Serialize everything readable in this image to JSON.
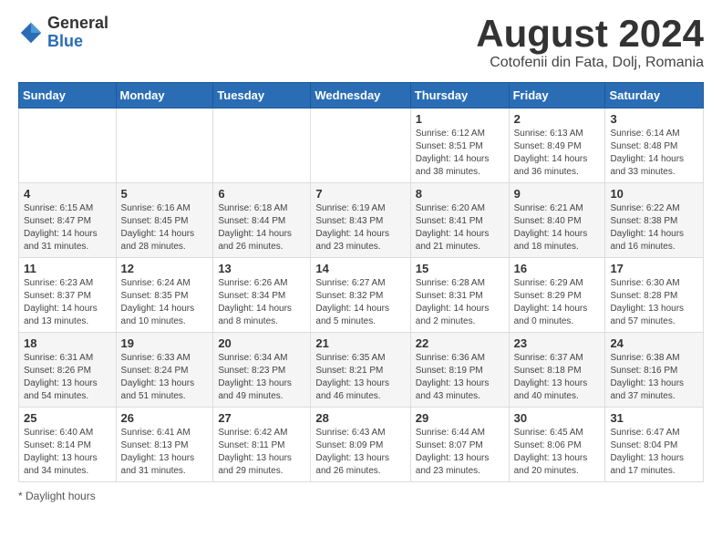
{
  "app": {
    "logo_general": "General",
    "logo_blue": "Blue"
  },
  "header": {
    "month": "August 2024",
    "location": "Cotofenii din Fata, Dolj, Romania"
  },
  "weekdays": [
    "Sunday",
    "Monday",
    "Tuesday",
    "Wednesday",
    "Thursday",
    "Friday",
    "Saturday"
  ],
  "weeks": [
    [
      {
        "day": "",
        "info": ""
      },
      {
        "day": "",
        "info": ""
      },
      {
        "day": "",
        "info": ""
      },
      {
        "day": "",
        "info": ""
      },
      {
        "day": "1",
        "info": "Sunrise: 6:12 AM\nSunset: 8:51 PM\nDaylight: 14 hours and 38 minutes."
      },
      {
        "day": "2",
        "info": "Sunrise: 6:13 AM\nSunset: 8:49 PM\nDaylight: 14 hours and 36 minutes."
      },
      {
        "day": "3",
        "info": "Sunrise: 6:14 AM\nSunset: 8:48 PM\nDaylight: 14 hours and 33 minutes."
      }
    ],
    [
      {
        "day": "4",
        "info": "Sunrise: 6:15 AM\nSunset: 8:47 PM\nDaylight: 14 hours and 31 minutes."
      },
      {
        "day": "5",
        "info": "Sunrise: 6:16 AM\nSunset: 8:45 PM\nDaylight: 14 hours and 28 minutes."
      },
      {
        "day": "6",
        "info": "Sunrise: 6:18 AM\nSunset: 8:44 PM\nDaylight: 14 hours and 26 minutes."
      },
      {
        "day": "7",
        "info": "Sunrise: 6:19 AM\nSunset: 8:43 PM\nDaylight: 14 hours and 23 minutes."
      },
      {
        "day": "8",
        "info": "Sunrise: 6:20 AM\nSunset: 8:41 PM\nDaylight: 14 hours and 21 minutes."
      },
      {
        "day": "9",
        "info": "Sunrise: 6:21 AM\nSunset: 8:40 PM\nDaylight: 14 hours and 18 minutes."
      },
      {
        "day": "10",
        "info": "Sunrise: 6:22 AM\nSunset: 8:38 PM\nDaylight: 14 hours and 16 minutes."
      }
    ],
    [
      {
        "day": "11",
        "info": "Sunrise: 6:23 AM\nSunset: 8:37 PM\nDaylight: 14 hours and 13 minutes."
      },
      {
        "day": "12",
        "info": "Sunrise: 6:24 AM\nSunset: 8:35 PM\nDaylight: 14 hours and 10 minutes."
      },
      {
        "day": "13",
        "info": "Sunrise: 6:26 AM\nSunset: 8:34 PM\nDaylight: 14 hours and 8 minutes."
      },
      {
        "day": "14",
        "info": "Sunrise: 6:27 AM\nSunset: 8:32 PM\nDaylight: 14 hours and 5 minutes."
      },
      {
        "day": "15",
        "info": "Sunrise: 6:28 AM\nSunset: 8:31 PM\nDaylight: 14 hours and 2 minutes."
      },
      {
        "day": "16",
        "info": "Sunrise: 6:29 AM\nSunset: 8:29 PM\nDaylight: 14 hours and 0 minutes."
      },
      {
        "day": "17",
        "info": "Sunrise: 6:30 AM\nSunset: 8:28 PM\nDaylight: 13 hours and 57 minutes."
      }
    ],
    [
      {
        "day": "18",
        "info": "Sunrise: 6:31 AM\nSunset: 8:26 PM\nDaylight: 13 hours and 54 minutes."
      },
      {
        "day": "19",
        "info": "Sunrise: 6:33 AM\nSunset: 8:24 PM\nDaylight: 13 hours and 51 minutes."
      },
      {
        "day": "20",
        "info": "Sunrise: 6:34 AM\nSunset: 8:23 PM\nDaylight: 13 hours and 49 minutes."
      },
      {
        "day": "21",
        "info": "Sunrise: 6:35 AM\nSunset: 8:21 PM\nDaylight: 13 hours and 46 minutes."
      },
      {
        "day": "22",
        "info": "Sunrise: 6:36 AM\nSunset: 8:19 PM\nDaylight: 13 hours and 43 minutes."
      },
      {
        "day": "23",
        "info": "Sunrise: 6:37 AM\nSunset: 8:18 PM\nDaylight: 13 hours and 40 minutes."
      },
      {
        "day": "24",
        "info": "Sunrise: 6:38 AM\nSunset: 8:16 PM\nDaylight: 13 hours and 37 minutes."
      }
    ],
    [
      {
        "day": "25",
        "info": "Sunrise: 6:40 AM\nSunset: 8:14 PM\nDaylight: 13 hours and 34 minutes."
      },
      {
        "day": "26",
        "info": "Sunrise: 6:41 AM\nSunset: 8:13 PM\nDaylight: 13 hours and 31 minutes."
      },
      {
        "day": "27",
        "info": "Sunrise: 6:42 AM\nSunset: 8:11 PM\nDaylight: 13 hours and 29 minutes."
      },
      {
        "day": "28",
        "info": "Sunrise: 6:43 AM\nSunset: 8:09 PM\nDaylight: 13 hours and 26 minutes."
      },
      {
        "day": "29",
        "info": "Sunrise: 6:44 AM\nSunset: 8:07 PM\nDaylight: 13 hours and 23 minutes."
      },
      {
        "day": "30",
        "info": "Sunrise: 6:45 AM\nSunset: 8:06 PM\nDaylight: 13 hours and 20 minutes."
      },
      {
        "day": "31",
        "info": "Sunrise: 6:47 AM\nSunset: 8:04 PM\nDaylight: 13 hours and 17 minutes."
      }
    ]
  ],
  "footer": {
    "note": "Daylight hours"
  }
}
